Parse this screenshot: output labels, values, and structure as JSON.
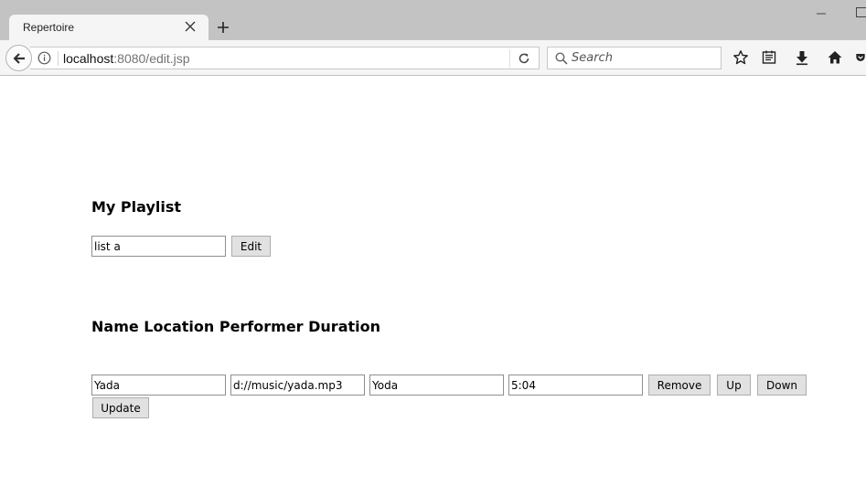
{
  "browser": {
    "tab_title": "Repertoire",
    "url_host": "localhost",
    "url_rest": ":8080/edit.jsp",
    "search_placeholder": "Search"
  },
  "playlist": {
    "heading": "My Playlist",
    "name_value": "list a",
    "edit_label": "Edit"
  },
  "songs": {
    "header": "Name Location Performer Duration",
    "rows": [
      {
        "name": "Yada",
        "location": "d://music/yada.mp3",
        "performer": "Yoda",
        "duration": "5:04",
        "remove_label": "Remove",
        "up_label": "Up",
        "down_label": "Down"
      }
    ],
    "update_label": "Update"
  }
}
